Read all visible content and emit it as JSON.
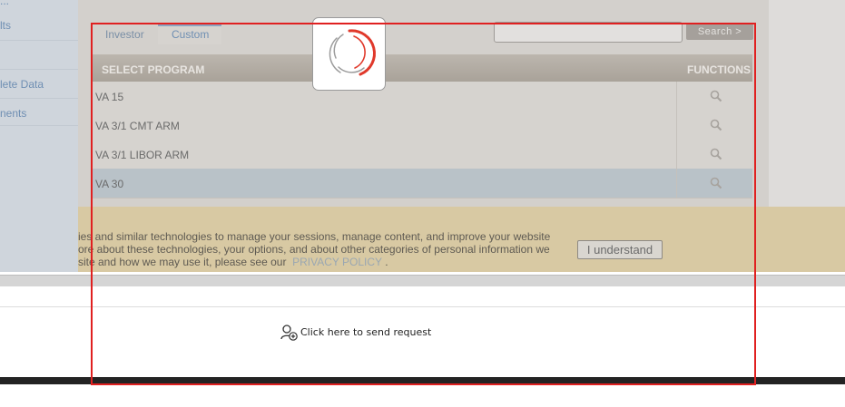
{
  "sidebar": {
    "items": [
      "lts",
      "lete Data",
      "nents"
    ],
    "top_fragment": "..."
  },
  "tabs": [
    {
      "label": "Investor"
    },
    {
      "label": "Custom"
    }
  ],
  "search": {
    "value": "",
    "button_label": "Search >"
  },
  "table": {
    "columns": [
      "SELECT PROGRAM",
      "FUNCTIONS"
    ],
    "rows": [
      {
        "program": "VA 15"
      },
      {
        "program": "VA 3/1 CMT ARM"
      },
      {
        "program": "VA 3/1 LIBOR ARM"
      },
      {
        "program": "VA 30"
      }
    ]
  },
  "cookie": {
    "line1": "ies and similar technologies to manage your sessions, manage content, and improve your website",
    "line2": "ore about these technologies, your options, and about other categories of personal information we",
    "line3": "site and how we may use it, please see our",
    "link_text": "PRIVACY POLICY",
    "after_link": ".",
    "button_label": "I understand"
  },
  "send_request": {
    "label": "Click here to send request",
    "icon": "user-add-icon"
  },
  "colors": {
    "annotation_frame": "#e02020",
    "spinner_arc": "#e0392b"
  }
}
